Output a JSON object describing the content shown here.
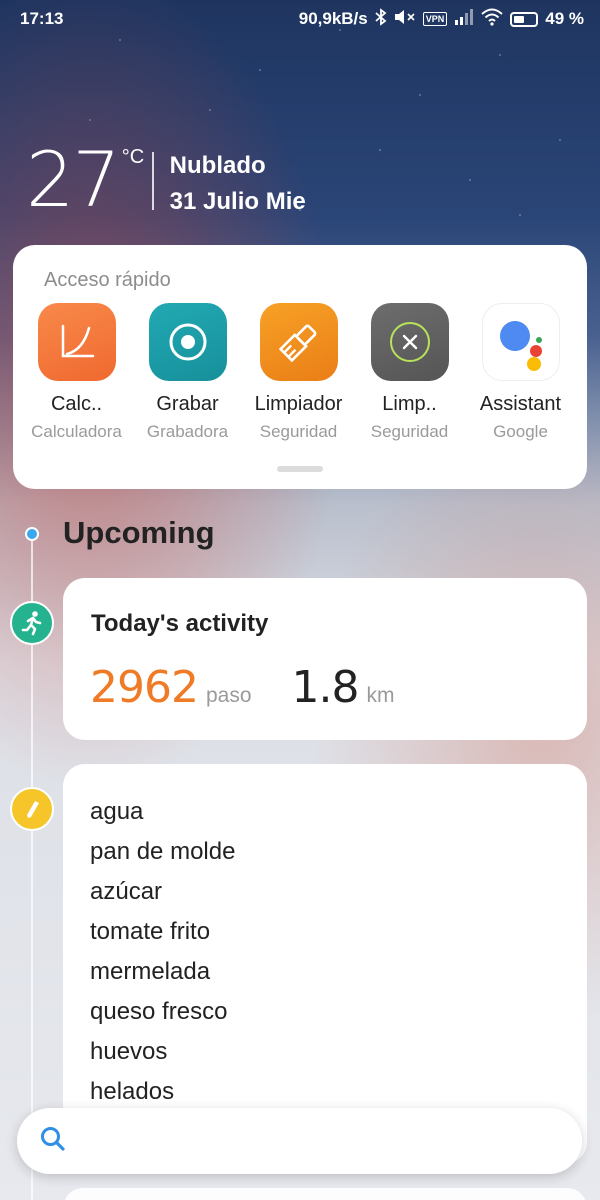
{
  "status_bar": {
    "time": "17:13",
    "network_speed": "90,9kB/s",
    "vpn": "VPN",
    "battery": "49 %",
    "icons": [
      "bluetooth-icon",
      "mute-icon",
      "vpn-icon",
      "signal-icon",
      "wifi-icon",
      "battery-icon"
    ]
  },
  "weather": {
    "temperature": "27",
    "unit": "°C",
    "condition": "Nublado",
    "date": "31 Julio Mie"
  },
  "quick_access": {
    "title": "Acceso rápido",
    "apps": [
      {
        "name": "Calc..",
        "subtitle": "Calculadora",
        "icon": "calculator-icon",
        "color": "#f47a3b"
      },
      {
        "name": "Grabar",
        "subtitle": "Grabadora",
        "icon": "recorder-icon",
        "color": "#1f9da7"
      },
      {
        "name": "Limpiador",
        "subtitle": "Seguridad",
        "icon": "cleaner-brush-icon",
        "color": "#f08c1f"
      },
      {
        "name": "Limp..",
        "subtitle": "Seguridad",
        "icon": "cleaner-x-icon",
        "color": "#666666"
      },
      {
        "name": "Assistant",
        "subtitle": "Google",
        "icon": "google-assistant-icon",
        "color": "#ffffff"
      }
    ]
  },
  "timeline": {
    "section_title": "Upcoming",
    "activity": {
      "title": "Today's activity",
      "steps_value": "2962",
      "steps_unit": "paso",
      "distance_value": "1.8",
      "distance_unit": "km",
      "accent_color": "#f07b26",
      "icon": "running-person-icon"
    },
    "notes": {
      "icon": "pencil-note-icon",
      "items": [
        "agua",
        "pan de molde",
        "azúcar",
        "tomate frito",
        "mermelada",
        "queso fresco",
        "huevos",
        "helados"
      ]
    }
  },
  "search": {
    "placeholder": "",
    "icon": "search-icon",
    "accent_color": "#2f8fe6"
  }
}
